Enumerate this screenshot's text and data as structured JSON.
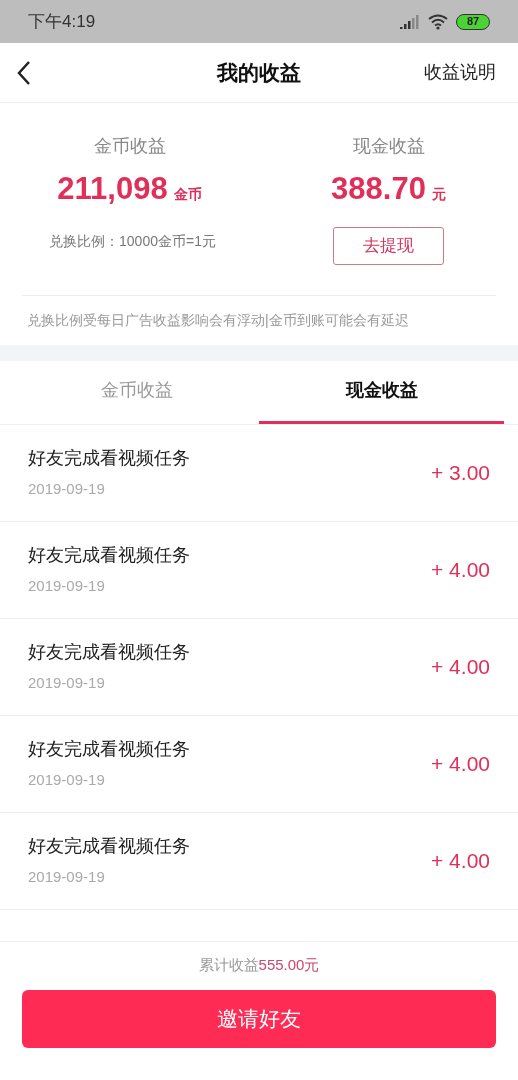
{
  "status_bar": {
    "time": "下午4:19",
    "battery": "87"
  },
  "header": {
    "title": "我的收益",
    "action": "收益说明"
  },
  "summary": {
    "coins": {
      "label": "金币收益",
      "value": "211,098",
      "unit": "金币",
      "note": "兑换比例：10000金币=1元"
    },
    "cash": {
      "label": "现金收益",
      "value": "388.70",
      "unit": "元",
      "button": "去提现"
    },
    "notice": "兑换比例受每日广告收益影响会有浮动|金币到账可能会有延迟"
  },
  "tabs": [
    {
      "label": "金币收益",
      "selected": false
    },
    {
      "label": "现金收益",
      "selected": true
    }
  ],
  "records": [
    {
      "title": "好友完成看视频任务",
      "date": "2019-09-19",
      "amount": "+ 3.00"
    },
    {
      "title": "好友完成看视频任务",
      "date": "2019-09-19",
      "amount": "+ 4.00"
    },
    {
      "title": "好友完成看视频任务",
      "date": "2019-09-19",
      "amount": "+ 4.00"
    },
    {
      "title": "好友完成看视频任务",
      "date": "2019-09-19",
      "amount": "+ 4.00"
    },
    {
      "title": "好友完成看视频任务",
      "date": "2019-09-19",
      "amount": "+ 4.00"
    }
  ],
  "footer": {
    "total_label": "累计收益",
    "total_value": "555.00元",
    "button": "邀请好友"
  }
}
